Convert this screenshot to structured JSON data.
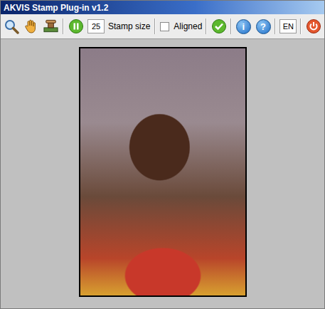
{
  "window": {
    "title": "AKVIS Stamp Plug-in v1.2"
  },
  "toolbar": {
    "stamp_size": {
      "value": "25",
      "label": "Stamp size"
    },
    "aligned": {
      "label": "Aligned",
      "checked": false
    },
    "info": {
      "glyph": "i"
    },
    "help": {
      "glyph": "?"
    },
    "language": "EN"
  }
}
